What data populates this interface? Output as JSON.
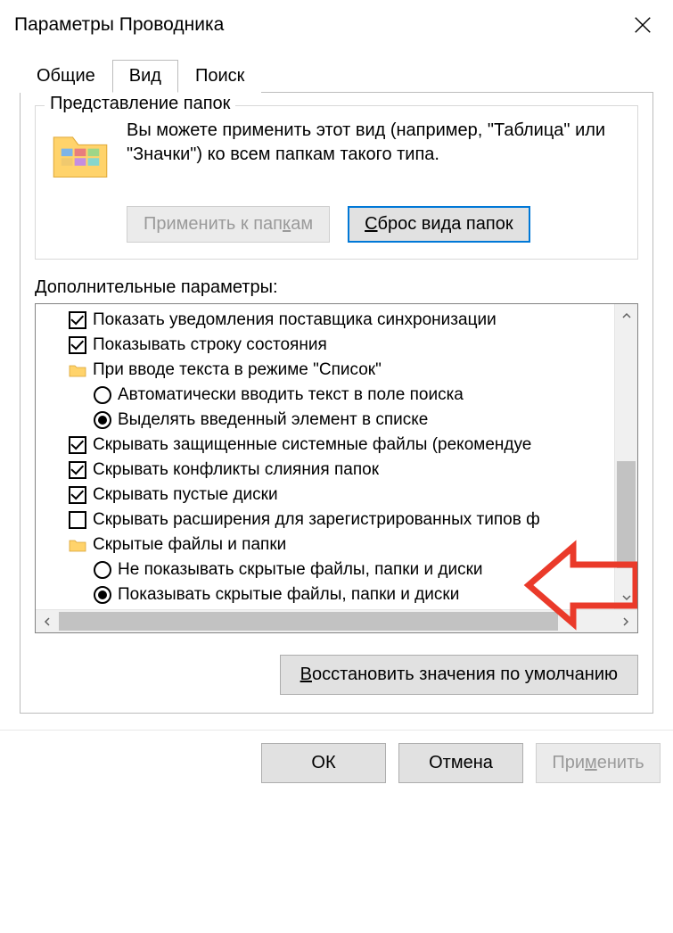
{
  "window": {
    "title": "Параметры Проводника"
  },
  "tabs": {
    "general": "Общие",
    "view": "Вид",
    "search": "Поиск",
    "active": "view"
  },
  "folder_views": {
    "legend": "Представление папок",
    "description": "Вы можете применить этот вид (например, \"Таблица\" или \"Значки\") ко всем папкам такого типа.",
    "apply_button": "Применить к папкам",
    "reset_button": "Сброс вида папок"
  },
  "advanced": {
    "label": "Дополнительные параметры:",
    "items": [
      {
        "type": "checkbox",
        "checked": true,
        "indent": 1,
        "label": "Показать уведомления поставщика синхронизации"
      },
      {
        "type": "checkbox",
        "checked": true,
        "indent": 1,
        "label": "Показывать строку состояния"
      },
      {
        "type": "folder",
        "indent": 1,
        "label": "При вводе текста в режиме \"Список\""
      },
      {
        "type": "radio",
        "checked": false,
        "indent": 2,
        "label": "Автоматически вводить текст в поле поиска"
      },
      {
        "type": "radio",
        "checked": true,
        "indent": 2,
        "label": "Выделять введенный элемент в списке"
      },
      {
        "type": "checkbox",
        "checked": true,
        "indent": 1,
        "label": "Скрывать защищенные системные файлы (рекомендуе"
      },
      {
        "type": "checkbox",
        "checked": true,
        "indent": 1,
        "label": "Скрывать конфликты слияния папок"
      },
      {
        "type": "checkbox",
        "checked": true,
        "indent": 1,
        "label": "Скрывать пустые диски"
      },
      {
        "type": "checkbox",
        "checked": false,
        "indent": 1,
        "label": "Скрывать расширения для зарегистрированных типов ф"
      },
      {
        "type": "folder",
        "indent": 1,
        "label": "Скрытые файлы и папки"
      },
      {
        "type": "radio",
        "checked": false,
        "indent": 2,
        "label": "Не показывать скрытые файлы, папки и диски"
      },
      {
        "type": "radio",
        "checked": true,
        "indent": 2,
        "label": "Показывать скрытые файлы, папки и диски"
      }
    ]
  },
  "restore_defaults": "Восстановить значения по умолчанию",
  "dialog_buttons": {
    "ok": "ОК",
    "cancel": "Отмена",
    "apply": "Применить"
  }
}
